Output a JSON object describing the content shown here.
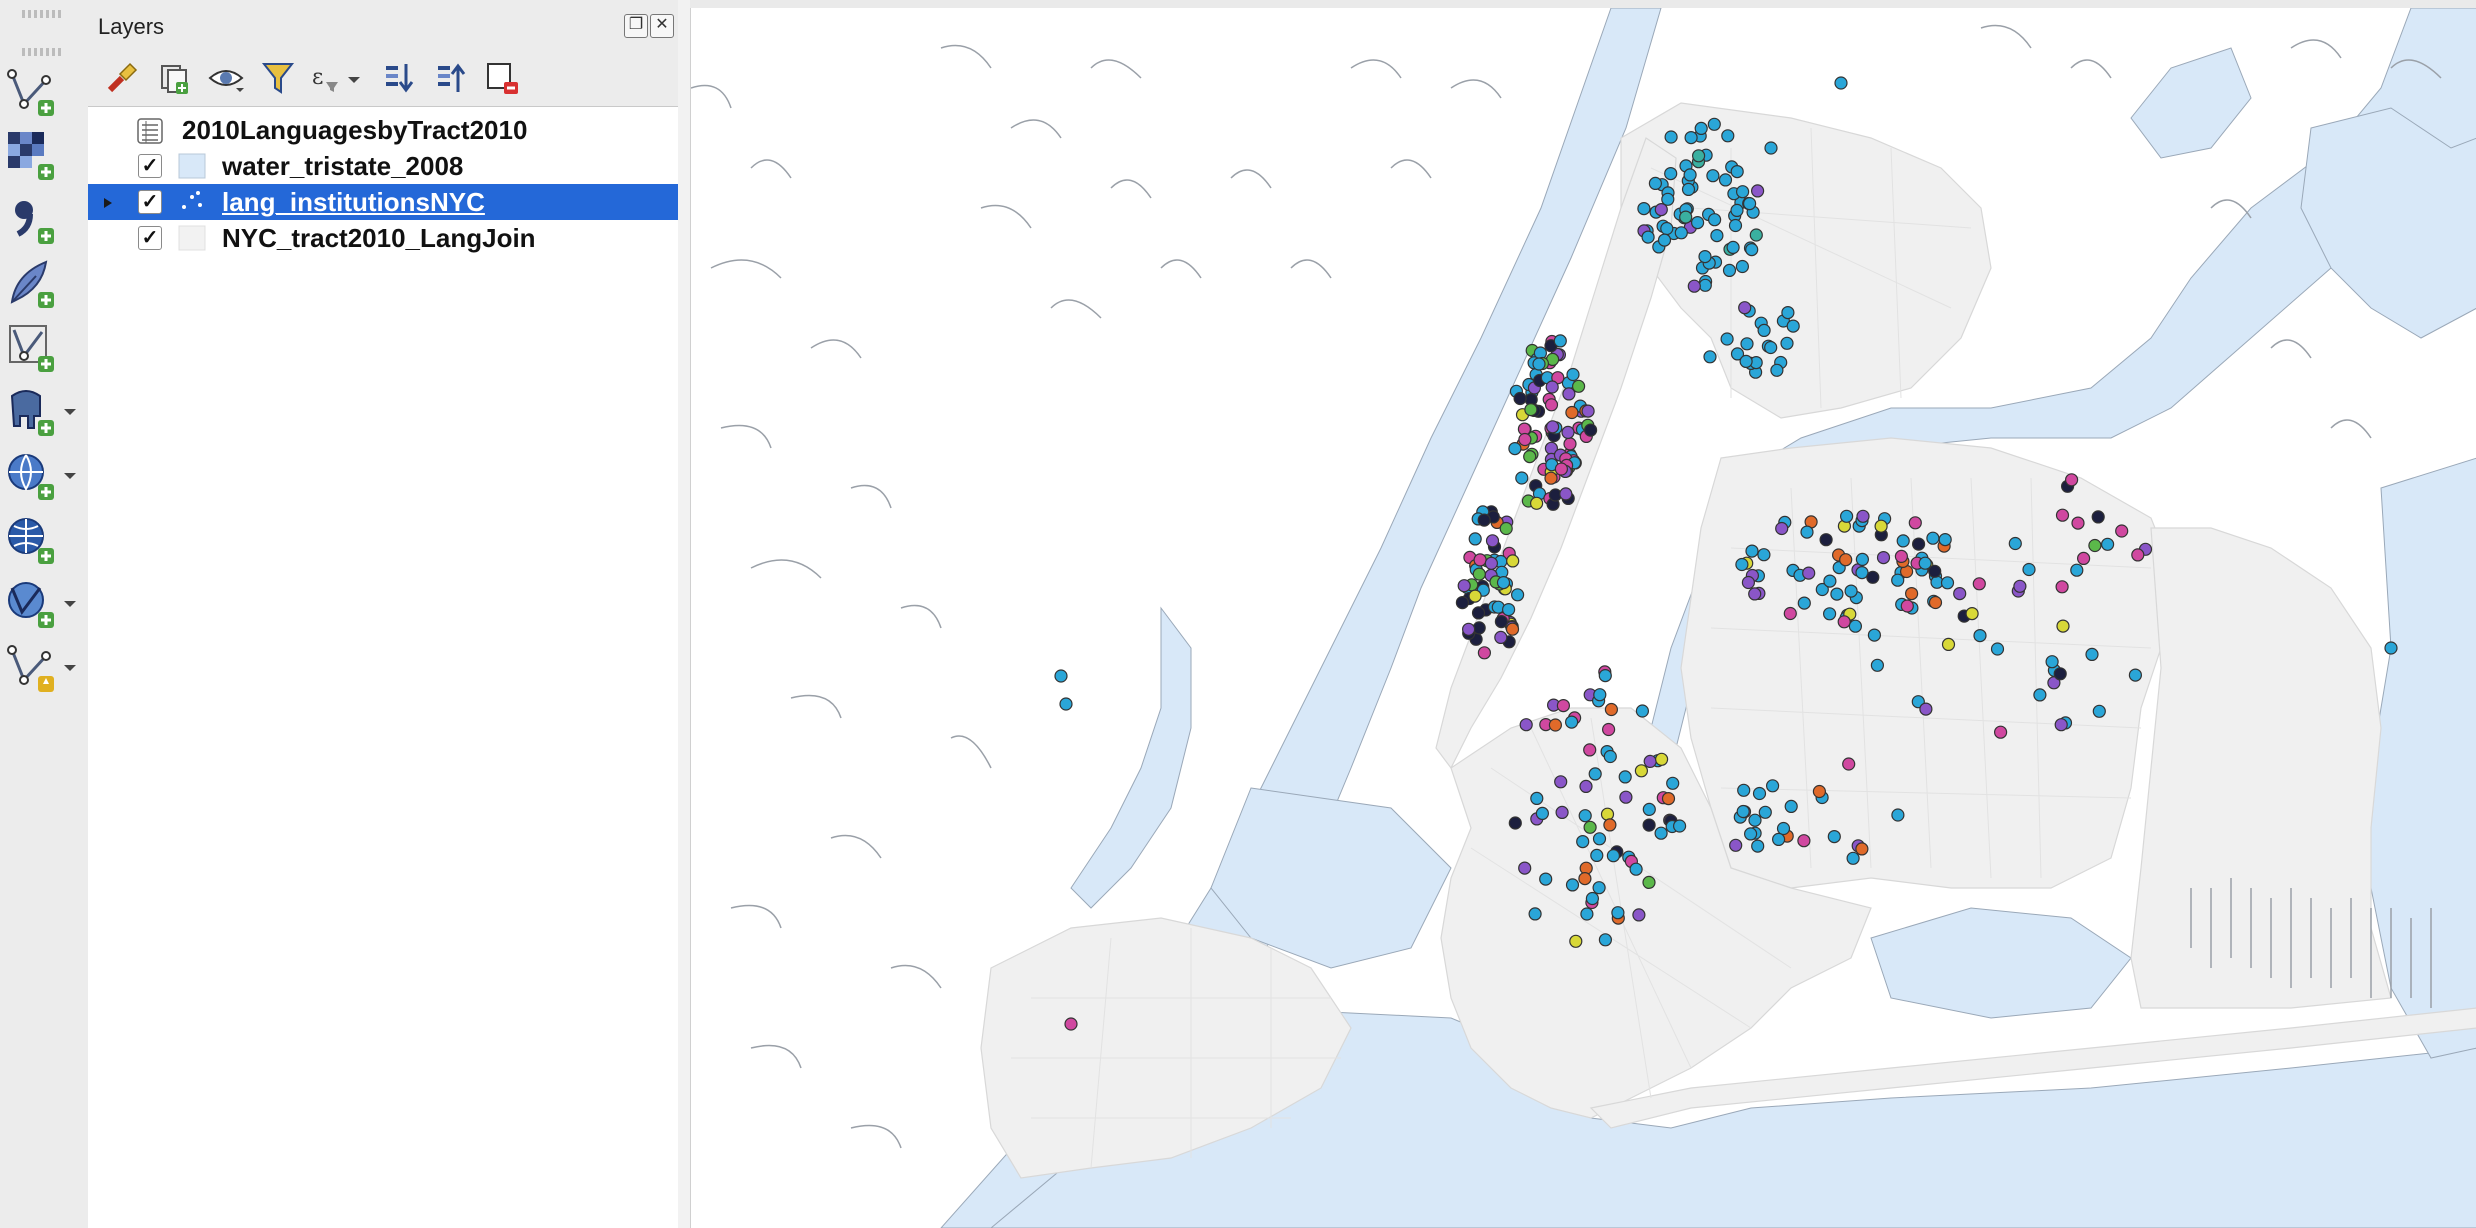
{
  "panel": {
    "title": "Layers",
    "float_icon": "float-window-icon",
    "close_icon": "close-icon"
  },
  "vertical_toolbar": [
    {
      "name": "add-vector-layer",
      "icon": "vector-add-icon"
    },
    {
      "name": "add-raster-layer",
      "icon": "raster-add-icon"
    },
    {
      "name": "add-delimited-text-layer",
      "icon": "comma-add-icon"
    },
    {
      "name": "add-spatialite-layer",
      "icon": "feather-add-icon"
    },
    {
      "name": "add-virtual-layer",
      "icon": "virtual-layer-add-icon"
    },
    {
      "name": "add-postgis-layer",
      "icon": "elephant-add-icon"
    },
    {
      "name": "add-wms-layer",
      "icon": "globe-add-icon"
    },
    {
      "name": "add-xyz-layer",
      "icon": "globe-xyz-add-icon"
    },
    {
      "name": "add-wfs-layer",
      "icon": "vector-globe-add-icon"
    },
    {
      "name": "new-shapefile-layer",
      "icon": "vector-new-icon"
    }
  ],
  "layers_toolbar": [
    "style-manager-icon",
    "add-group-icon",
    "visibility-icon",
    "filter-icon",
    "expression-filter-icon",
    "expand-all-icon",
    "collapse-all-icon",
    "remove-layer-icon"
  ],
  "layers": [
    {
      "name": "2010LanguagesbyTract2010",
      "checked": false,
      "type": "table",
      "selected": false
    },
    {
      "name": "water_tristate_2008",
      "checked": true,
      "type": "polygon",
      "selected": false
    },
    {
      "name": "lang_institutionsNYC",
      "checked": true,
      "type": "point",
      "selected": true
    },
    {
      "name": "NYC_tract2010_LangJoin",
      "checked": true,
      "type": "polygon",
      "selected": false
    }
  ],
  "check_glyph": "✓",
  "colors": {
    "water": "#d8e8f8",
    "land": "#f0f0f0",
    "selection": "#2468d8",
    "points": [
      "#2aa6d8",
      "#8a56c8",
      "#d048a0",
      "#1c1f3e",
      "#5bb84a",
      "#e06a2a",
      "#d8d838",
      "#3ab0a0"
    ]
  }
}
